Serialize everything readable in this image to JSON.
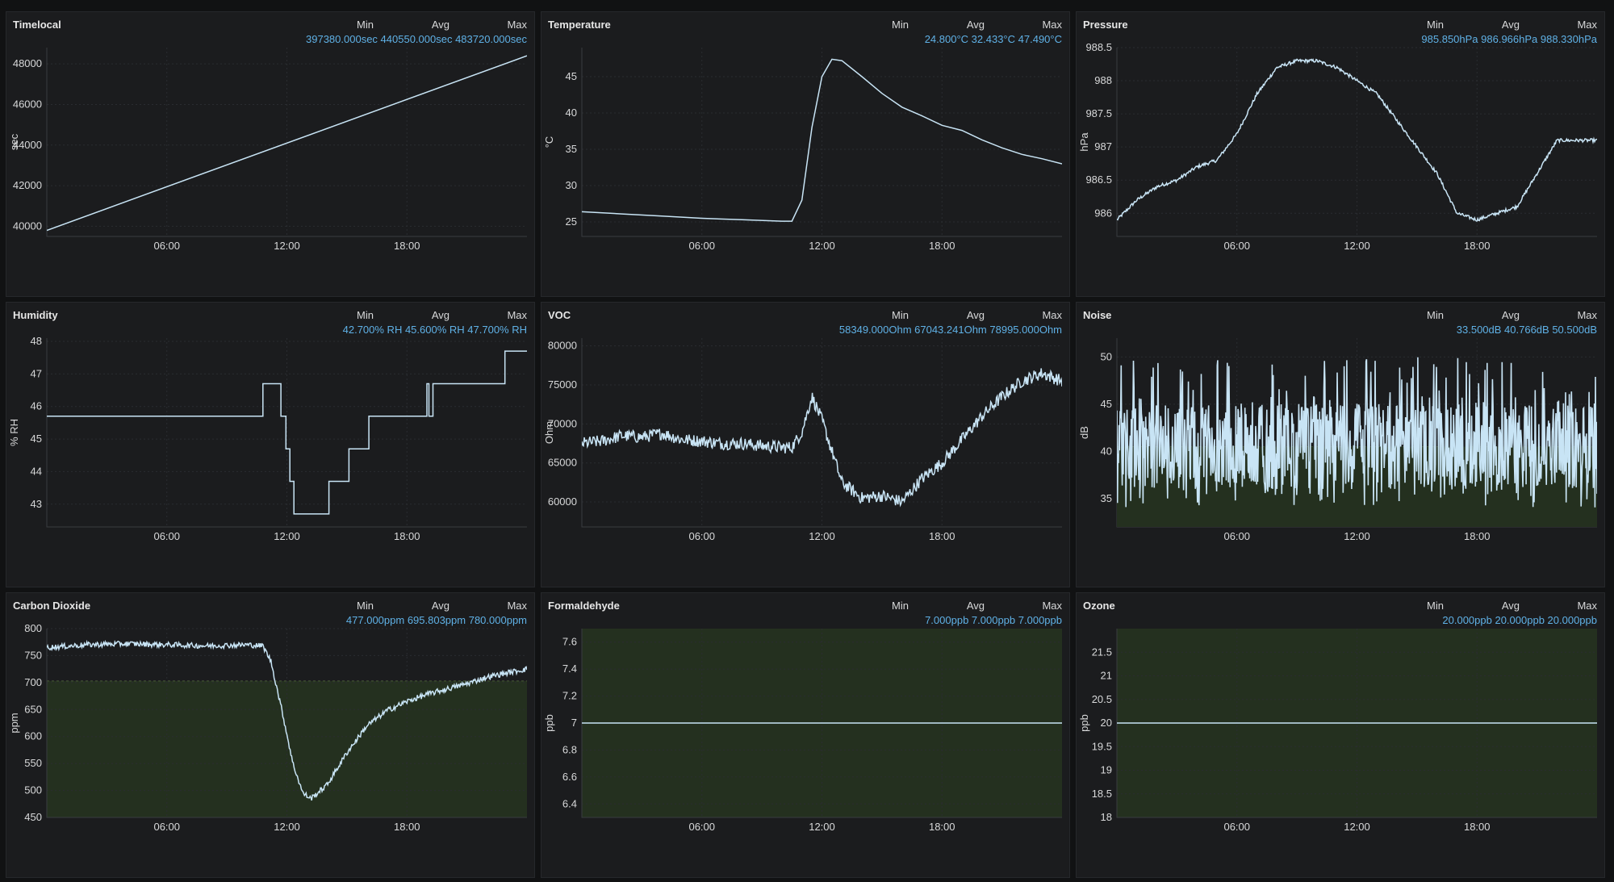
{
  "colors": {
    "background": "#111213",
    "panel_bg": "#1b1c1e",
    "line": "#c8e4f5",
    "legend_value": "#5fb1e6",
    "threshold_fill": "#24301f",
    "axis_text": "#d8d9da"
  },
  "legend_headers": [
    "Min",
    "Avg",
    "Max"
  ],
  "x_ticks": [
    "06:00",
    "12:00",
    "18:00"
  ],
  "chart_data": [
    {
      "id": "timelocal",
      "type": "line",
      "title": "Timelocal",
      "ylabel": "sec",
      "ylim": [
        39500,
        48800
      ],
      "yticks": [
        40000,
        42000,
        44000,
        46000,
        48000
      ],
      "yticklabels": [
        "40000",
        "42000",
        "44000",
        "46000",
        "48000"
      ],
      "legend": {
        "min": "397380.000sec",
        "avg": "440550.000sec",
        "max": "483720.000sec"
      },
      "x": [
        0,
        24
      ],
      "y": [
        39800,
        48400
      ]
    },
    {
      "id": "temperature",
      "type": "line",
      "title": "Temperature",
      "ylabel": "°C",
      "ylim": [
        23,
        49
      ],
      "yticks": [
        25,
        30,
        35,
        40,
        45
      ],
      "yticklabels": [
        "25",
        "30",
        "35",
        "40",
        "45"
      ],
      "legend": {
        "min": "24.800°C",
        "avg": "32.433°C",
        "max": "47.490°C"
      },
      "x": [
        0,
        2,
        4,
        6,
        8,
        10,
        10.5,
        11,
        11.5,
        12,
        12.5,
        13,
        14,
        15,
        16,
        17,
        18,
        19,
        20,
        21,
        22,
        23,
        24
      ],
      "y": [
        26.4,
        26.1,
        25.8,
        25.5,
        25.3,
        25.1,
        25.1,
        28,
        38,
        45,
        47.4,
        47.2,
        45,
        42.7,
        40.8,
        39.6,
        38.3,
        37.6,
        36.3,
        35.2,
        34.3,
        33.7,
        33.0
      ]
    },
    {
      "id": "pressure",
      "type": "line",
      "title": "Pressure",
      "ylabel": "hPa",
      "ylim": [
        985.65,
        988.5
      ],
      "yticks": [
        986,
        986.5,
        987,
        987.5,
        988,
        988.5
      ],
      "yticklabels": [
        "986",
        "986.5",
        "987",
        "987.5",
        "988",
        "988.5"
      ],
      "legend": {
        "min": "985.850hPa",
        "avg": "986.966hPa",
        "max": "988.330hPa"
      },
      "noise": 0.05,
      "x": [
        0,
        1,
        2,
        3,
        4,
        5,
        6,
        7,
        8,
        9,
        10,
        11,
        12,
        13,
        14,
        15,
        16,
        17,
        18,
        19,
        20,
        21,
        22,
        23,
        24
      ],
      "y": [
        985.9,
        986.2,
        986.4,
        986.5,
        986.7,
        986.8,
        987.2,
        987.8,
        988.2,
        988.3,
        988.3,
        988.2,
        988.0,
        987.8,
        987.4,
        987.0,
        986.6,
        986.0,
        985.9,
        986.0,
        986.1,
        986.6,
        987.1,
        987.1,
        987.1
      ]
    },
    {
      "id": "humidity",
      "type": "line",
      "title": "Humidity",
      "ylabel": "% RH",
      "ylim": [
        42.3,
        48.1
      ],
      "yticks": [
        43,
        44,
        45,
        46,
        47,
        48
      ],
      "yticklabels": [
        "43",
        "44",
        "45",
        "46",
        "47",
        "48"
      ],
      "legend": {
        "min": "42.700% RH",
        "avg": "45.600% RH",
        "max": "47.700% RH"
      },
      "x": [
        0,
        10.8,
        10.8,
        11.7,
        11.7,
        11.95,
        11.95,
        12.15,
        12.15,
        12.35,
        12.35,
        14.1,
        14.1,
        15.1,
        15.1,
        16.1,
        16.1,
        19.0,
        19.0,
        19.1,
        19.1,
        19.3,
        19.3,
        19.6,
        19.6,
        22.9,
        22.9,
        24
      ],
      "y": [
        45.7,
        45.7,
        46.7,
        46.7,
        45.7,
        45.7,
        44.7,
        44.7,
        43.7,
        43.7,
        42.7,
        42.7,
        43.7,
        43.7,
        44.7,
        44.7,
        45.7,
        45.7,
        46.7,
        46.7,
        45.7,
        45.7,
        46.7,
        46.7,
        46.7,
        46.7,
        47.7,
        47.7
      ]
    },
    {
      "id": "voc",
      "type": "line",
      "title": "VOC",
      "ylabel": "Ohm",
      "ylim": [
        56800,
        81000
      ],
      "yticks": [
        60000,
        65000,
        70000,
        75000,
        80000
      ],
      "yticklabels": [
        "60000",
        "65000",
        "70000",
        "75000",
        "80000"
      ],
      "legend": {
        "min": "58349.000Ohm",
        "avg": "67043.241Ohm",
        "max": "78995.000Ohm"
      },
      "noise": 1600,
      "x": [
        0,
        1,
        2,
        3,
        4,
        5,
        6,
        7,
        8,
        9,
        10,
        10.5,
        11,
        11.5,
        12,
        12.5,
        13,
        14,
        15,
        16,
        17,
        18,
        19,
        20,
        21,
        22,
        23,
        24
      ],
      "y": [
        67500,
        67800,
        68500,
        68300,
        68800,
        68000,
        67800,
        67500,
        67500,
        67200,
        67000,
        67000,
        69000,
        73500,
        70500,
        66500,
        62500,
        60500,
        60800,
        60000,
        63000,
        65000,
        68000,
        71000,
        73500,
        75500,
        76500,
        75500
      ]
    },
    {
      "id": "noise",
      "type": "area",
      "title": "Noise",
      "ylabel": "dB",
      "ylim": [
        32,
        52
      ],
      "yticks": [
        35,
        40,
        45,
        50
      ],
      "yticklabels": [
        "35",
        "40",
        "45",
        "50"
      ],
      "legend": {
        "min": "33.500dB",
        "avg": "40.766dB",
        "max": "50.500dB"
      },
      "threshold": 40.5,
      "x": [
        0,
        24
      ],
      "y": [
        40.8,
        40.8
      ]
    },
    {
      "id": "co2",
      "type": "line",
      "title": "Carbon Dioxide",
      "ylabel": "ppm",
      "ylim": [
        450,
        800
      ],
      "yticks": [
        450,
        500,
        550,
        600,
        650,
        700,
        750,
        800
      ],
      "yticklabels": [
        "450",
        "500",
        "550",
        "600",
        "650",
        "700",
        "750",
        "800"
      ],
      "legend": {
        "min": "477.000ppm",
        "avg": "695.803ppm",
        "max": "780.000ppm"
      },
      "threshold": 703,
      "noise": 10,
      "x": [
        0,
        2,
        4,
        6,
        8,
        10,
        10.8,
        11.2,
        11.8,
        12.3,
        12.8,
        13.2,
        14,
        15,
        16,
        17,
        18,
        19,
        20,
        21,
        22,
        23,
        24
      ],
      "y": [
        765,
        770,
        772,
        770,
        768,
        770,
        768,
        740,
        640,
        550,
        495,
        485,
        510,
        570,
        620,
        648,
        665,
        678,
        688,
        698,
        710,
        718,
        725
      ]
    },
    {
      "id": "formaldehyde",
      "type": "line",
      "title": "Formaldehyde",
      "ylabel": "ppb",
      "ylim": [
        6.3,
        7.7
      ],
      "yticks": [
        6.4,
        6.6,
        6.8,
        7.0,
        7.2,
        7.4,
        7.6
      ],
      "yticklabels": [
        "6.4",
        "6.6",
        "6.8",
        "7",
        "7.2",
        "7.4",
        "7.6"
      ],
      "legend": {
        "min": "7.000ppb",
        "avg": "7.000ppb",
        "max": "7.000ppb"
      },
      "threshold": 7.7,
      "x": [
        0,
        24
      ],
      "y": [
        7.0,
        7.0
      ]
    },
    {
      "id": "ozone",
      "type": "line",
      "title": "Ozone",
      "ylabel": "ppb",
      "ylim": [
        18,
        22
      ],
      "yticks": [
        18,
        18.5,
        19,
        19.5,
        20,
        20.5,
        21,
        21.5
      ],
      "yticklabels": [
        "18",
        "18.5",
        "19",
        "19.5",
        "20",
        "20.5",
        "21",
        "21.5"
      ],
      "legend": {
        "min": "20.000ppb",
        "avg": "20.000ppb",
        "max": "20.000ppb"
      },
      "threshold": 22,
      "x": [
        0,
        24
      ],
      "y": [
        20.0,
        20.0
      ]
    }
  ]
}
